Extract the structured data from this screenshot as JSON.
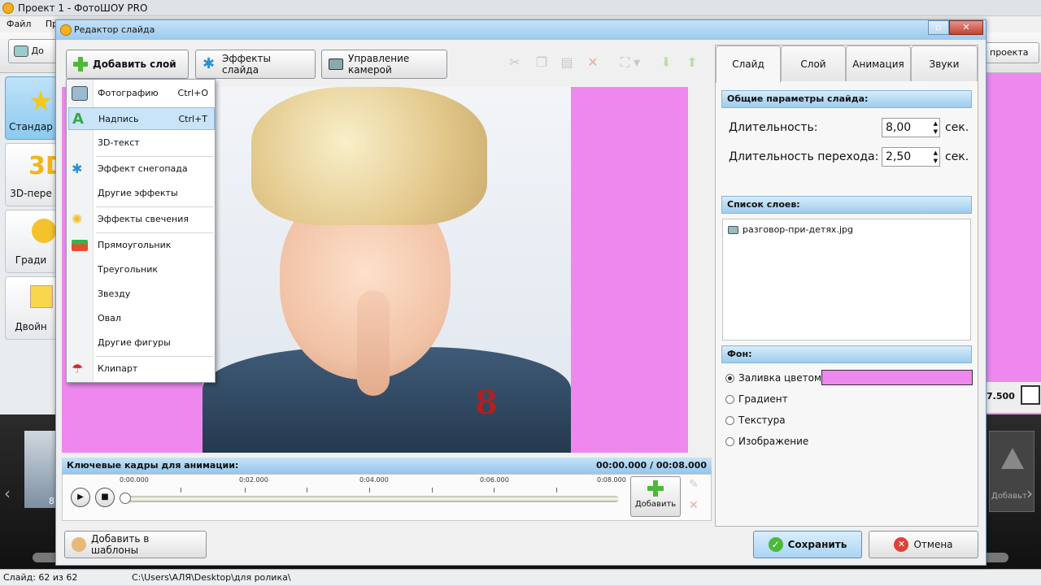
{
  "main_window": {
    "title": "Проект 1 - ФотоШОУ PRO",
    "menu": [
      "Файл",
      "Пра"
    ],
    "toolbar_left": "До",
    "toolbar_right": "проекта",
    "left_tiles": [
      "Стандар",
      "3D-пере",
      "Гради",
      "Двойн"
    ],
    "side_value": "7.500",
    "film_number": "8",
    "film_add_label": "Добавьт",
    "status_slide": "Слайд: 62 из 62",
    "status_path": "C:\\Users\\АЛЯ\\Desktop\\для ролика\\"
  },
  "dialog": {
    "title": "Редактор слайда",
    "toolbar": {
      "add_layer": "Добавить слой",
      "slide_effects": "Эффекты слайда",
      "camera": "Управление камерой"
    },
    "add_layer_menu": [
      {
        "label": "Фотографию",
        "shortcut": "Ctrl+O",
        "icon": "photo-icon"
      },
      {
        "label": "Надпись",
        "shortcut": "Ctrl+T",
        "icon": "text-a-icon",
        "highlighted": true
      },
      {
        "label": "3D-текст",
        "shortcut": ""
      },
      {
        "label": "Эффект снегопада",
        "shortcut": "",
        "icon": "snowflake-icon"
      },
      {
        "label": "Другие эффекты",
        "shortcut": ""
      },
      {
        "label": "Эффекты свечения",
        "shortcut": "",
        "icon": "glow-icon"
      },
      {
        "label": "Прямоугольник",
        "shortcut": "",
        "icon": "rectangles-icon"
      },
      {
        "label": "Треугольник",
        "shortcut": ""
      },
      {
        "label": "Звезду",
        "shortcut": ""
      },
      {
        "label": "Овал",
        "shortcut": ""
      },
      {
        "label": "Другие фигуры",
        "shortcut": ""
      },
      {
        "label": "Клипарт",
        "shortcut": "",
        "icon": "clipart-umbrella-icon"
      }
    ],
    "timeline": {
      "header": "Ключевые кадры для анимации:",
      "time": "00:00.000 / 00:08.000",
      "ticks": [
        "0:00.000",
        "0:02.000",
        "0:04.000",
        "0:06.000",
        "0:08.000"
      ],
      "add_label": "Добавить"
    },
    "tabs": [
      "Слайд",
      "Слой",
      "Анимация",
      "Звуки"
    ],
    "active_tab": "Слайд",
    "general": {
      "header": "Общие параметры слайда:",
      "duration_label": "Длительность:",
      "duration_value": "8,00",
      "transition_label": "Длительность перехода:",
      "transition_value": "2,50",
      "unit": "сек."
    },
    "layers": {
      "header": "Список слоев:",
      "items": [
        "разговор-при-детях.jpg"
      ]
    },
    "background": {
      "header": "Фон:",
      "options": [
        "Заливка цветом",
        "Градиент",
        "Текстура",
        "Изображение"
      ],
      "selected": "Заливка цветом",
      "fill_color": "#ee88ee"
    },
    "buttons": {
      "add_template": "Добавить в шаблоны",
      "save": "Сохранить",
      "cancel": "Отмена"
    }
  },
  "colors": {
    "canvas_bg": "#ee88ee",
    "accent": "#9ccaee"
  }
}
